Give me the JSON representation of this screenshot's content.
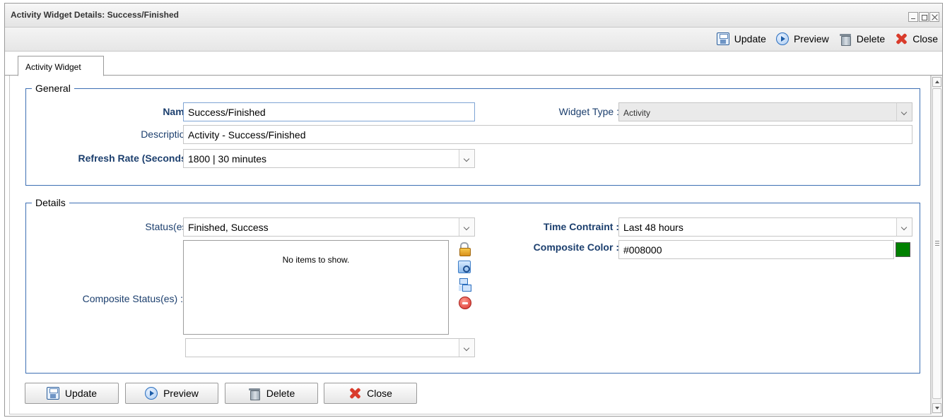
{
  "window": {
    "title": "Activity Widget Details: Success/Finished"
  },
  "toolbar": {
    "update_label": "Update",
    "preview_label": "Preview",
    "delete_label": "Delete",
    "close_label": "Close"
  },
  "tabs": [
    {
      "label": "Activity Widget",
      "active": true
    }
  ],
  "general": {
    "legend": "General",
    "name_label": "Name :",
    "name_value": "Success/Finished",
    "widget_type_label": "Widget Type :",
    "widget_type_value": "Activity",
    "description_label": "Description :",
    "description_value": "Activity - Success/Finished",
    "refresh_label": "Refresh Rate (Seconds) :",
    "refresh_value": "1800 | 30 minutes"
  },
  "details": {
    "legend": "Details",
    "statuses_label": "Status(es) :",
    "statuses_value": "Finished, Success",
    "time_label": "Time Contraint :",
    "time_value": "Last 48 hours",
    "composite_color_label": "Composite Color :",
    "composite_color_value": "#008000",
    "composite_statuses_label": "Composite Status(es) :",
    "composite_empty_text": "No items to show.",
    "composite_select_value": ""
  },
  "footer": {
    "update_label": "Update",
    "preview_label": "Preview",
    "delete_label": "Delete",
    "close_label": "Close"
  },
  "icons": {
    "save": "save-icon",
    "preview": "preview-icon",
    "delete": "delete-icon",
    "close": "close-icon",
    "unlock": "unlock-icon",
    "find": "find-icon",
    "tree": "tree-icon",
    "remove": "remove-icon"
  },
  "colors": {
    "accent_border": "#3d6fb3",
    "label_text": "#1c3f6e",
    "composite_swatch": "#008000",
    "close_icon": "#d93b2b"
  }
}
